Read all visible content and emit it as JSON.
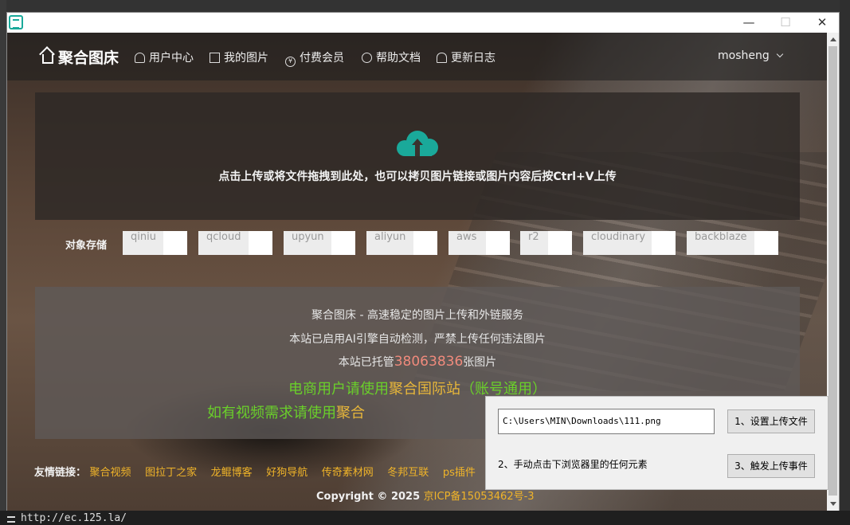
{
  "window": {
    "minimize": "—",
    "maximize": "☐",
    "close": "✕"
  },
  "navbar": {
    "brand": "聚合图床",
    "items": [
      {
        "label": "用户中心",
        "icon": "user-icon"
      },
      {
        "label": "我的图片",
        "icon": "image-icon"
      },
      {
        "label": "付费会员",
        "icon": "yen-icon"
      },
      {
        "label": "帮助文档",
        "icon": "info-icon"
      },
      {
        "label": "更新日志",
        "icon": "bell-icon"
      }
    ],
    "username": "mosheng"
  },
  "upload": {
    "hint": "点击上传或将文件拖拽到此处，也可以拷贝图片链接或图片内容后按Ctrl+V上传",
    "icon": "cloud-upload-icon",
    "icon_color": "#1aa99a"
  },
  "storage": {
    "label": "对象存储",
    "options": [
      "qiniu",
      "qcloud",
      "upyun",
      "aliyun",
      "aws",
      "r2",
      "cloudinary",
      "backblaze"
    ]
  },
  "info": {
    "line1": "聚合图床 - 高速稳定的图片上传和外链服务",
    "line2": "本站已启用AI引擎自动检测，严禁上传任何违法图片",
    "line3_prefix": "本站已托管",
    "count": "38063836",
    "line3_suffix": "张图片",
    "promo1_prefix": "电商用户请使用",
    "promo1_highlight": "聚合国际站",
    "promo1_suffix": "（账号通用）",
    "promo2_prefix": "如有视频需求请使用",
    "promo2_highlight": "聚合"
  },
  "footer": {
    "links_label": "友情链接：",
    "links": [
      "聚合视频",
      "图拉丁之家",
      "龙鲲博客",
      "好狗导航",
      "传奇素材网",
      "冬邦互联",
      "ps插件"
    ],
    "copyright": "Copyright © 2025",
    "icp": "京ICP备15053462号-3"
  },
  "helper": {
    "file_path": "C:\\Users\\MIN\\Downloads\\111.png",
    "set_file_button": "1、设置上传文件",
    "instruction": "2、手动点击下浏览器里的任何元素",
    "trigger_button": "3、触发上传事件"
  },
  "desktop": {
    "statusbar_url": "http://ec.125.la/"
  }
}
